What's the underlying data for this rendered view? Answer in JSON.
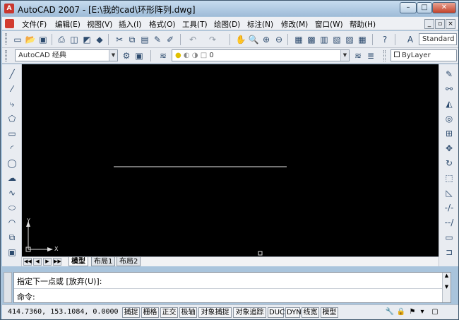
{
  "window": {
    "app_icon_letter": "A",
    "title": "AutoCAD 2007 - [E:\\我的cad\\环形阵列.dwg]",
    "controls": {
      "minimize": "–",
      "maximize": "□",
      "close": "✕"
    }
  },
  "menu": {
    "items": [
      "文件(F)",
      "编辑(E)",
      "视图(V)",
      "插入(I)",
      "格式(O)",
      "工具(T)",
      "绘图(D)",
      "标注(N)",
      "修改(M)",
      "窗口(W)",
      "帮助(H)"
    ],
    "mdi_controls": [
      "_",
      "▫",
      "×"
    ]
  },
  "toolbar1": {
    "text_style": "Standard"
  },
  "toolbar2": {
    "workspace": "AutoCAD 经典",
    "layer": "0",
    "linetype": "ByLayer"
  },
  "canvas": {
    "background": "#000000",
    "ucs_labels": {
      "x": "X",
      "y": "Y"
    }
  },
  "layout_tabs": {
    "tabs": [
      "模型",
      "布局1",
      "布局2"
    ],
    "active": "模型"
  },
  "command": {
    "history": "指定下一点或 [放弃(U)]:",
    "prompt": "命令:"
  },
  "status": {
    "coordinates": "414.7360, 153.1084, 0.0000",
    "buttons": [
      "捕捉",
      "栅格",
      "正交",
      "极轴",
      "对象捕捉",
      "对象追踪",
      "DUCS",
      "DYN",
      "线宽",
      "模型"
    ]
  }
}
